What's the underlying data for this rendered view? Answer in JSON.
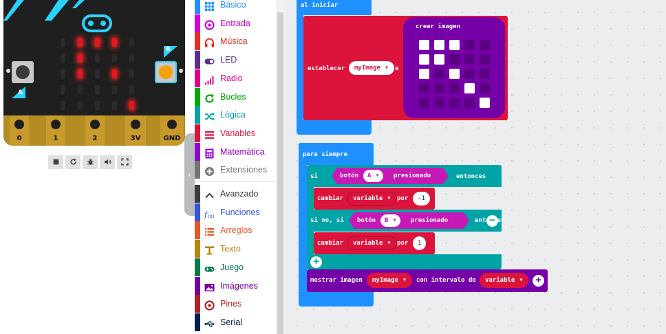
{
  "simulator": {
    "pins": [
      "0",
      "1",
      "2",
      "3V",
      "GND"
    ],
    "button_a_label": "A",
    "button_b_label": "B",
    "led_matrix": [
      [
        0,
        1,
        1,
        1,
        0
      ],
      [
        0,
        1,
        0,
        0,
        0
      ],
      [
        0,
        1,
        0,
        1,
        0
      ],
      [
        0,
        0,
        0,
        0,
        0
      ],
      [
        0,
        0,
        0,
        0,
        1
      ]
    ],
    "toolbar": [
      "stop-icon",
      "restart-icon",
      "debug-icon",
      "sound-icon",
      "fullscreen-icon"
    ],
    "colors": {
      "led_on": "#e0191f",
      "board": "#1f1f1f",
      "edge": "#c79a2b",
      "logo": "#2ad2ff",
      "button_b": "#f5a20a"
    }
  },
  "toolbox": {
    "categories": [
      {
        "label": "Básico",
        "color": "#1e90ff",
        "icon": "grid-icon"
      },
      {
        "label": "Entrada",
        "color": "#d400d4",
        "icon": "target-icon"
      },
      {
        "label": "Música",
        "color": "#e63022",
        "icon": "headphones-icon"
      },
      {
        "label": "LED",
        "color": "#5c2d91",
        "icon": "toggle-icon"
      },
      {
        "label": "Radio",
        "color": "#e3008c",
        "icon": "signal-icon"
      },
      {
        "label": "Bucles",
        "color": "#00aa00",
        "icon": "refresh-icon"
      },
      {
        "label": "Lógica",
        "color": "#00a4a6",
        "icon": "shuffle-icon"
      },
      {
        "label": "Variables",
        "color": "#dc143c",
        "icon": "lines-icon"
      },
      {
        "label": "Matemática",
        "color": "#9400d3",
        "icon": "calculator-icon"
      },
      {
        "label": "Extensiones",
        "color": "#757575",
        "icon": "plus-circle-icon"
      }
    ],
    "advanced": [
      {
        "label": "Avanzado",
        "color": "#3c3c3c",
        "icon": "chevron-up-icon"
      },
      {
        "label": "Funciones",
        "color": "#3455db",
        "icon": "function-icon"
      },
      {
        "label": "Arreglos",
        "color": "#e65722",
        "icon": "list-icon"
      },
      {
        "label": "Texto",
        "color": "#b8860b",
        "icon": "text-icon"
      },
      {
        "label": "Juego",
        "color": "#007a4b",
        "icon": "gamepad-icon"
      },
      {
        "label": "Imágenes",
        "color": "#7600a8",
        "icon": "image-icon"
      },
      {
        "label": "Pines",
        "color": "#b22222",
        "icon": "target-icon"
      },
      {
        "label": "Serial",
        "color": "#002050",
        "icon": "usb-icon"
      }
    ]
  },
  "workspace": {
    "on_start": {
      "label": "al iniciar",
      "set_label": "establecer",
      "variable": "myImage",
      "to_label": "a",
      "create_image_label": "crear imagen",
      "image": [
        [
          1,
          1,
          1,
          0,
          0
        ],
        [
          1,
          1,
          0,
          0,
          0
        ],
        [
          1,
          0,
          1,
          0,
          0
        ],
        [
          0,
          0,
          0,
          1,
          0
        ],
        [
          0,
          0,
          0,
          0,
          1
        ]
      ]
    },
    "forever": {
      "label": "para siempre",
      "if_label": "si",
      "button_label": "botón",
      "button_a": "A",
      "pressed_label": "presionado",
      "then_label": "entonces",
      "change_label": "cambiar",
      "variable": "variable",
      "by_label": "por",
      "change_a_value": "-1",
      "else_if_label": "si no, si",
      "button_b": "B",
      "change_b_value": "1",
      "show_label": "mostrar imagen",
      "show_var": "myImage",
      "interval_label": "con intervalo de",
      "interval_var": "variable"
    },
    "colors": {
      "basic": "#1e90ff",
      "variables": "#dc143c",
      "logic": "#00a4a6",
      "input": "#c719b5",
      "images": "#7600a8"
    }
  }
}
